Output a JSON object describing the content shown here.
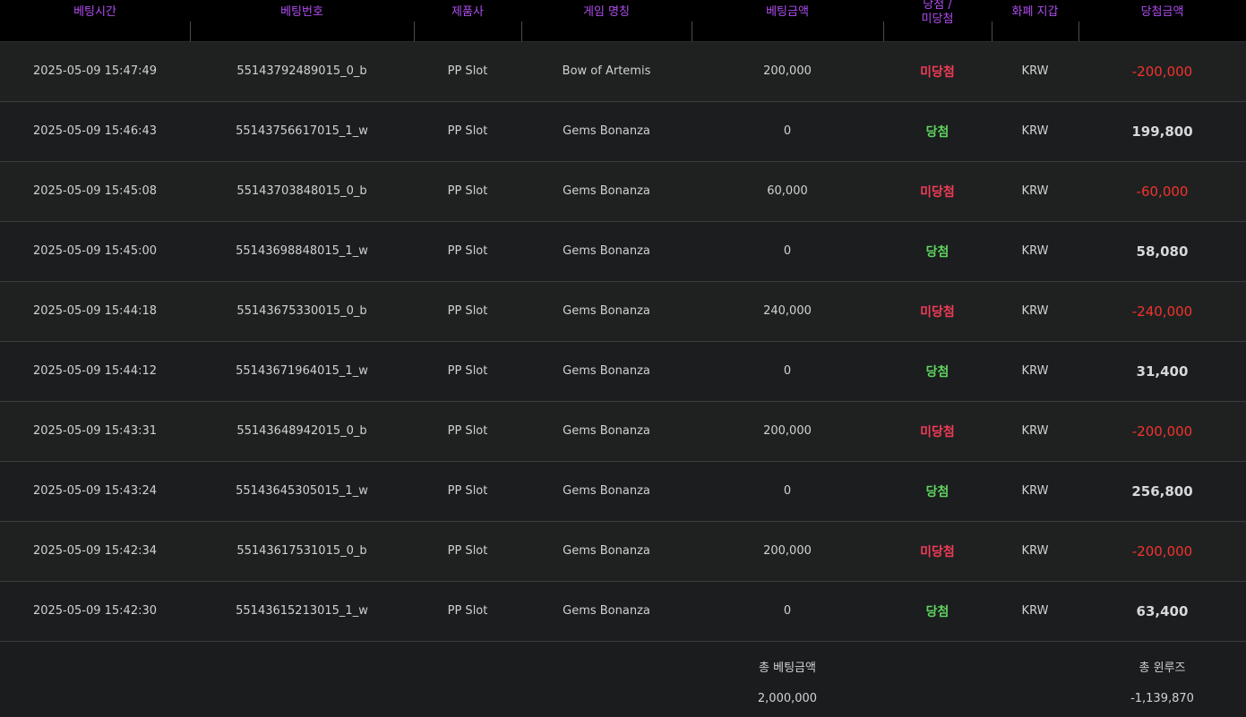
{
  "table": {
    "headers": [
      {
        "label": "베팅시간"
      },
      {
        "label": "베팅번호"
      },
      {
        "label": "제품사"
      },
      {
        "label": "게임 명칭"
      },
      {
        "label": "베팅금액"
      },
      {
        "label_top": "당첨 /",
        "label": "미당첨"
      },
      {
        "label": "화폐 지갑"
      },
      {
        "label": "당첨금액"
      }
    ],
    "rows": [
      {
        "time": "2025-05-09 15:47:49",
        "bet_id": "55143792489015_0_b",
        "provider": "PP Slot",
        "game": "Bow of Artemis",
        "bet_amount": "200,000",
        "result": "미당첨",
        "currency": "KRW",
        "win_amount": "-200,000"
      },
      {
        "time": "2025-05-09 15:46:43",
        "bet_id": "55143756617015_1_w",
        "provider": "PP Slot",
        "game": "Gems Bonanza",
        "bet_amount": "0",
        "result": "당첨",
        "currency": "KRW",
        "win_amount": "199,800"
      },
      {
        "time": "2025-05-09 15:45:08",
        "bet_id": "55143703848015_0_b",
        "provider": "PP Slot",
        "game": "Gems Bonanza",
        "bet_amount": "60,000",
        "result": "미당첨",
        "currency": "KRW",
        "win_amount": "-60,000"
      },
      {
        "time": "2025-05-09 15:45:00",
        "bet_id": "55143698848015_1_w",
        "provider": "PP Slot",
        "game": "Gems Bonanza",
        "bet_amount": "0",
        "result": "당첨",
        "currency": "KRW",
        "win_amount": "58,080"
      },
      {
        "time": "2025-05-09 15:44:18",
        "bet_id": "55143675330015_0_b",
        "provider": "PP Slot",
        "game": "Gems Bonanza",
        "bet_amount": "240,000",
        "result": "미당첨",
        "currency": "KRW",
        "win_amount": "-240,000"
      },
      {
        "time": "2025-05-09 15:44:12",
        "bet_id": "55143671964015_1_w",
        "provider": "PP Slot",
        "game": "Gems Bonanza",
        "bet_amount": "0",
        "result": "당첨",
        "currency": "KRW",
        "win_amount": "31,400"
      },
      {
        "time": "2025-05-09 15:43:31",
        "bet_id": "55143648942015_0_b",
        "provider": "PP Slot",
        "game": "Gems Bonanza",
        "bet_amount": "200,000",
        "result": "미당첨",
        "currency": "KRW",
        "win_amount": "-200,000"
      },
      {
        "time": "2025-05-09 15:43:24",
        "bet_id": "55143645305015_1_w",
        "provider": "PP Slot",
        "game": "Gems Bonanza",
        "bet_amount": "0",
        "result": "당첨",
        "currency": "KRW",
        "win_amount": "256,800"
      },
      {
        "time": "2025-05-09 15:42:34",
        "bet_id": "55143617531015_0_b",
        "provider": "PP Slot",
        "game": "Gems Bonanza",
        "bet_amount": "200,000",
        "result": "미당첨",
        "currency": "KRW",
        "win_amount": "-200,000"
      },
      {
        "time": "2025-05-09 15:42:30",
        "bet_id": "55143615213015_1_w",
        "provider": "PP Slot",
        "game": "Gems Bonanza",
        "bet_amount": "0",
        "result": "당첨",
        "currency": "KRW",
        "win_amount": "63,400"
      }
    ]
  },
  "summary": {
    "total_bet_label": "총 베팅금액",
    "total_bet_value": "2,000,000",
    "total_winloss_label": "총 윈루즈",
    "total_winloss_value": "-1,139,870"
  },
  "colors": {
    "header_text": "#b04cf0",
    "win": "#5fd35f",
    "lose": "#f03b55",
    "negative_amount": "#f2332c"
  }
}
